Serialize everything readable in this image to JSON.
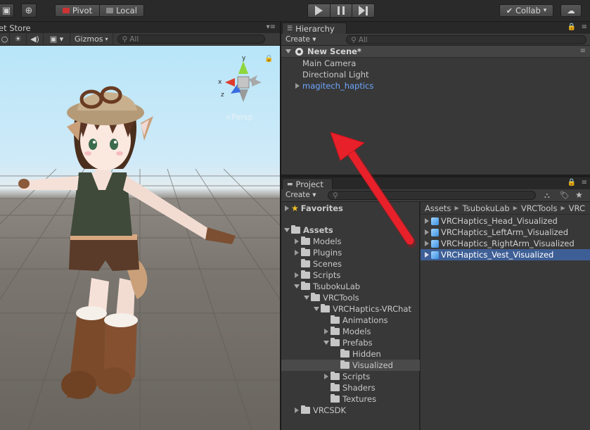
{
  "toolbar": {
    "pivot_label": "Pivot",
    "local_label": "Local",
    "collab_label": "Collab",
    "collab_arrow": "▾"
  },
  "scene": {
    "tab_label": "et Store",
    "gizmos_label": "Gizmos",
    "dropdown_arrow": "▾",
    "search_placeholder": "All",
    "persp_label": "Persp",
    "axis_x": "x",
    "axis_y": "y",
    "axis_z": "z"
  },
  "hierarchy": {
    "tab_label": "Hierarchy",
    "create_label": "Create",
    "search_placeholder": "All",
    "scene_name": "New Scene*",
    "items": [
      {
        "label": "Main Camera",
        "prefab": false
      },
      {
        "label": "Directional Light",
        "prefab": false
      },
      {
        "label": "magitech_haptics",
        "prefab": true
      }
    ]
  },
  "project": {
    "tab_label": "Project",
    "create_label": "Create",
    "favorites_label": "Favorites",
    "assets_label": "Assets",
    "tree": [
      {
        "label": "Models"
      },
      {
        "label": "Plugins"
      },
      {
        "label": "Scenes"
      },
      {
        "label": "Scripts"
      },
      {
        "label": "TsubokuLab"
      },
      {
        "label": "VRCTools"
      },
      {
        "label": "VRCHaptics-VRChat"
      },
      {
        "label": "Animations"
      },
      {
        "label": "Models"
      },
      {
        "label": "Prefabs"
      },
      {
        "label": "Hidden"
      },
      {
        "label": "Visualized"
      },
      {
        "label": "Scripts"
      },
      {
        "label": "Shaders"
      },
      {
        "label": "Textures"
      },
      {
        "label": "VRCSDK"
      }
    ],
    "breadcrumb": [
      "Assets",
      "TsubokuLab",
      "VRCTools",
      "VRC"
    ],
    "assets": [
      {
        "label": "VRCHaptics_Head_Visualized"
      },
      {
        "label": "VRCHaptics_LeftArm_Visualized"
      },
      {
        "label": "VRCHaptics_RightArm_Visualized"
      },
      {
        "label": "VRCHaptics_Vest_Visualized"
      }
    ]
  },
  "colors": {
    "annotation_arrow": "#e8202a",
    "selection": "#3e5f96",
    "prefab_text": "#6ea6ff"
  }
}
